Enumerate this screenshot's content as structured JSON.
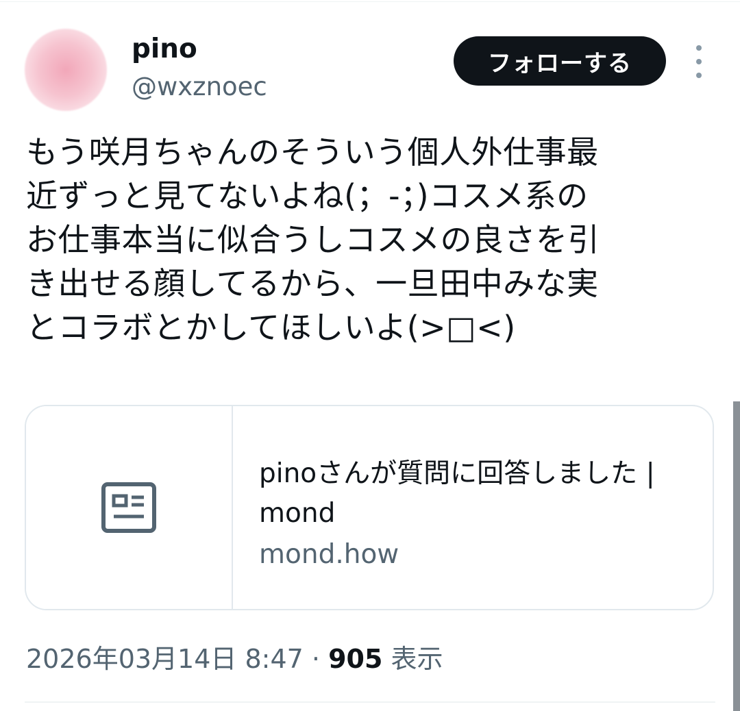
{
  "author": {
    "name": "pino",
    "handle": "@wxznoec"
  },
  "follow_button": {
    "label": "フォローする"
  },
  "tweet": {
    "text": "もう咲月ちゃんのそういう個人外仕事最\n近ずっと見てないよね(；-；)コスメ系の\nお仕事本当に似合うしコスメの良さを引\nき出せる顔してるから、一旦田中みな実\nとコラボとかしてほしいよ(>□<)"
  },
  "link_card": {
    "icon": "article-icon",
    "title": "pinoさんが質問に回答しました | mond",
    "domain": "mond.how"
  },
  "meta": {
    "timestamp": "2026年03月14日 8:47",
    "separator": "·",
    "views_count": "905",
    "views_label": "表示"
  },
  "colors": {
    "text_primary": "#0f1419",
    "text_secondary": "#536471",
    "border": "#e1e8ed",
    "follow_button_bg": "#0f1419"
  }
}
